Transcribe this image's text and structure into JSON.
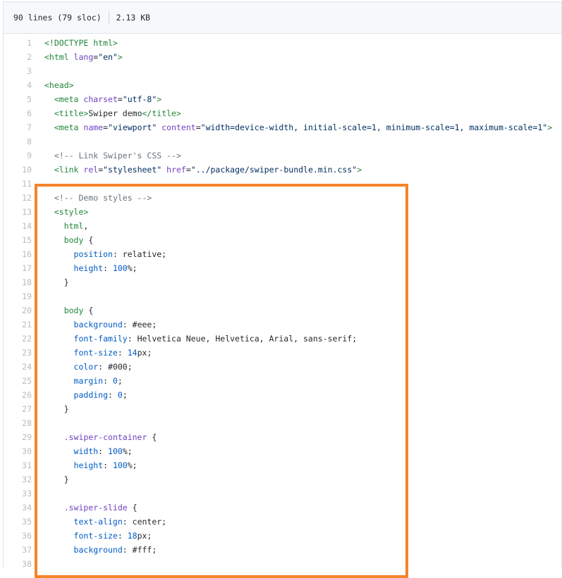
{
  "file_info": {
    "lines": "90 lines (79 sloc)",
    "size": "2.13 KB"
  },
  "colors": {
    "highlight": "#f5842a"
  },
  "code_lines": [
    {
      "n": "1",
      "t": [
        [
          "tag",
          "<!DOCTYPE html>"
        ]
      ]
    },
    {
      "n": "2",
      "t": [
        [
          "tag",
          "<html "
        ],
        [
          "attr",
          "lang"
        ],
        [
          "txt",
          "="
        ],
        [
          "str",
          "\"en\""
        ],
        [
          "tag",
          ">"
        ]
      ]
    },
    {
      "n": "3",
      "t": []
    },
    {
      "n": "4",
      "t": [
        [
          "tag",
          "<head>"
        ]
      ]
    },
    {
      "n": "5",
      "t": [
        [
          "txt",
          "  "
        ],
        [
          "tag",
          "<meta "
        ],
        [
          "attr",
          "charset"
        ],
        [
          "txt",
          "="
        ],
        [
          "str",
          "\"utf-8\""
        ],
        [
          "tag",
          ">"
        ]
      ]
    },
    {
      "n": "6",
      "t": [
        [
          "txt",
          "  "
        ],
        [
          "tag",
          "<title>"
        ],
        [
          "txt",
          "Swiper demo"
        ],
        [
          "tag",
          "</title>"
        ]
      ]
    },
    {
      "n": "7",
      "t": [
        [
          "txt",
          "  "
        ],
        [
          "tag",
          "<meta "
        ],
        [
          "attr",
          "name"
        ],
        [
          "txt",
          "="
        ],
        [
          "str",
          "\"viewport\""
        ],
        [
          "txt",
          " "
        ],
        [
          "attr",
          "content"
        ],
        [
          "txt",
          "="
        ],
        [
          "str",
          "\"width=device-width, initial-scale=1, minimum-scale=1, maximum-scale=1\""
        ],
        [
          "tag",
          ">"
        ]
      ]
    },
    {
      "n": "8",
      "t": []
    },
    {
      "n": "9",
      "t": [
        [
          "txt",
          "  "
        ],
        [
          "com",
          "<!-- Link Swiper's CSS -->"
        ]
      ]
    },
    {
      "n": "10",
      "t": [
        [
          "txt",
          "  "
        ],
        [
          "tag",
          "<link "
        ],
        [
          "attr",
          "rel"
        ],
        [
          "txt",
          "="
        ],
        [
          "str",
          "\"stylesheet\""
        ],
        [
          "txt",
          " "
        ],
        [
          "attr",
          "href"
        ],
        [
          "txt",
          "="
        ],
        [
          "str",
          "\"../package/swiper-bundle.min.css\""
        ],
        [
          "tag",
          ">"
        ]
      ]
    },
    {
      "n": "11",
      "t": []
    },
    {
      "n": "12",
      "t": [
        [
          "txt",
          "  "
        ],
        [
          "com",
          "<!-- Demo styles -->"
        ]
      ]
    },
    {
      "n": "13",
      "t": [
        [
          "txt",
          "  "
        ],
        [
          "tag",
          "<style>"
        ]
      ]
    },
    {
      "n": "14",
      "t": [
        [
          "txt",
          "    "
        ],
        [
          "tag",
          "html"
        ],
        [
          "txt",
          ","
        ]
      ]
    },
    {
      "n": "15",
      "t": [
        [
          "txt",
          "    "
        ],
        [
          "tag",
          "body"
        ],
        [
          "txt",
          " {"
        ]
      ]
    },
    {
      "n": "16",
      "t": [
        [
          "txt",
          "      "
        ],
        [
          "prop",
          "position"
        ],
        [
          "txt",
          ": relative;"
        ]
      ]
    },
    {
      "n": "17",
      "t": [
        [
          "txt",
          "      "
        ],
        [
          "prop",
          "height"
        ],
        [
          "txt",
          ": "
        ],
        [
          "num",
          "100"
        ],
        [
          "txt",
          "%;"
        ]
      ]
    },
    {
      "n": "18",
      "t": [
        [
          "txt",
          "    }"
        ]
      ]
    },
    {
      "n": "19",
      "t": []
    },
    {
      "n": "20",
      "t": [
        [
          "txt",
          "    "
        ],
        [
          "tag",
          "body"
        ],
        [
          "txt",
          " {"
        ]
      ]
    },
    {
      "n": "21",
      "t": [
        [
          "txt",
          "      "
        ],
        [
          "prop",
          "background"
        ],
        [
          "txt",
          ": #eee;"
        ]
      ]
    },
    {
      "n": "22",
      "t": [
        [
          "txt",
          "      "
        ],
        [
          "prop",
          "font-family"
        ],
        [
          "txt",
          ": Helvetica Neue, Helvetica, Arial, sans-serif;"
        ]
      ]
    },
    {
      "n": "23",
      "t": [
        [
          "txt",
          "      "
        ],
        [
          "prop",
          "font-size"
        ],
        [
          "txt",
          ": "
        ],
        [
          "num",
          "14"
        ],
        [
          "txt",
          "px;"
        ]
      ]
    },
    {
      "n": "24",
      "t": [
        [
          "txt",
          "      "
        ],
        [
          "prop",
          "color"
        ],
        [
          "txt",
          ": #000;"
        ]
      ]
    },
    {
      "n": "25",
      "t": [
        [
          "txt",
          "      "
        ],
        [
          "prop",
          "margin"
        ],
        [
          "txt",
          ": "
        ],
        [
          "num",
          "0"
        ],
        [
          "txt",
          ";"
        ]
      ]
    },
    {
      "n": "26",
      "t": [
        [
          "txt",
          "      "
        ],
        [
          "prop",
          "padding"
        ],
        [
          "txt",
          ": "
        ],
        [
          "num",
          "0"
        ],
        [
          "txt",
          ";"
        ]
      ]
    },
    {
      "n": "27",
      "t": [
        [
          "txt",
          "    }"
        ]
      ]
    },
    {
      "n": "28",
      "t": []
    },
    {
      "n": "29",
      "t": [
        [
          "txt",
          "    "
        ],
        [
          "sel",
          ".swiper-container"
        ],
        [
          "txt",
          " {"
        ]
      ]
    },
    {
      "n": "30",
      "t": [
        [
          "txt",
          "      "
        ],
        [
          "prop",
          "width"
        ],
        [
          "txt",
          ": "
        ],
        [
          "num",
          "100"
        ],
        [
          "txt",
          "%;"
        ]
      ]
    },
    {
      "n": "31",
      "t": [
        [
          "txt",
          "      "
        ],
        [
          "prop",
          "height"
        ],
        [
          "txt",
          ": "
        ],
        [
          "num",
          "100"
        ],
        [
          "txt",
          "%;"
        ]
      ]
    },
    {
      "n": "32",
      "t": [
        [
          "txt",
          "    }"
        ]
      ]
    },
    {
      "n": "33",
      "t": []
    },
    {
      "n": "34",
      "t": [
        [
          "txt",
          "    "
        ],
        [
          "sel",
          ".swiper-slide"
        ],
        [
          "txt",
          " {"
        ]
      ]
    },
    {
      "n": "35",
      "t": [
        [
          "txt",
          "      "
        ],
        [
          "prop",
          "text-align"
        ],
        [
          "txt",
          ": center;"
        ]
      ]
    },
    {
      "n": "36",
      "t": [
        [
          "txt",
          "      "
        ],
        [
          "prop",
          "font-size"
        ],
        [
          "txt",
          ": "
        ],
        [
          "num",
          "18"
        ],
        [
          "txt",
          "px;"
        ]
      ]
    },
    {
      "n": "37",
      "t": [
        [
          "txt",
          "      "
        ],
        [
          "prop",
          "background"
        ],
        [
          "txt",
          ": #fff;"
        ]
      ]
    },
    {
      "n": "38",
      "t": []
    }
  ]
}
